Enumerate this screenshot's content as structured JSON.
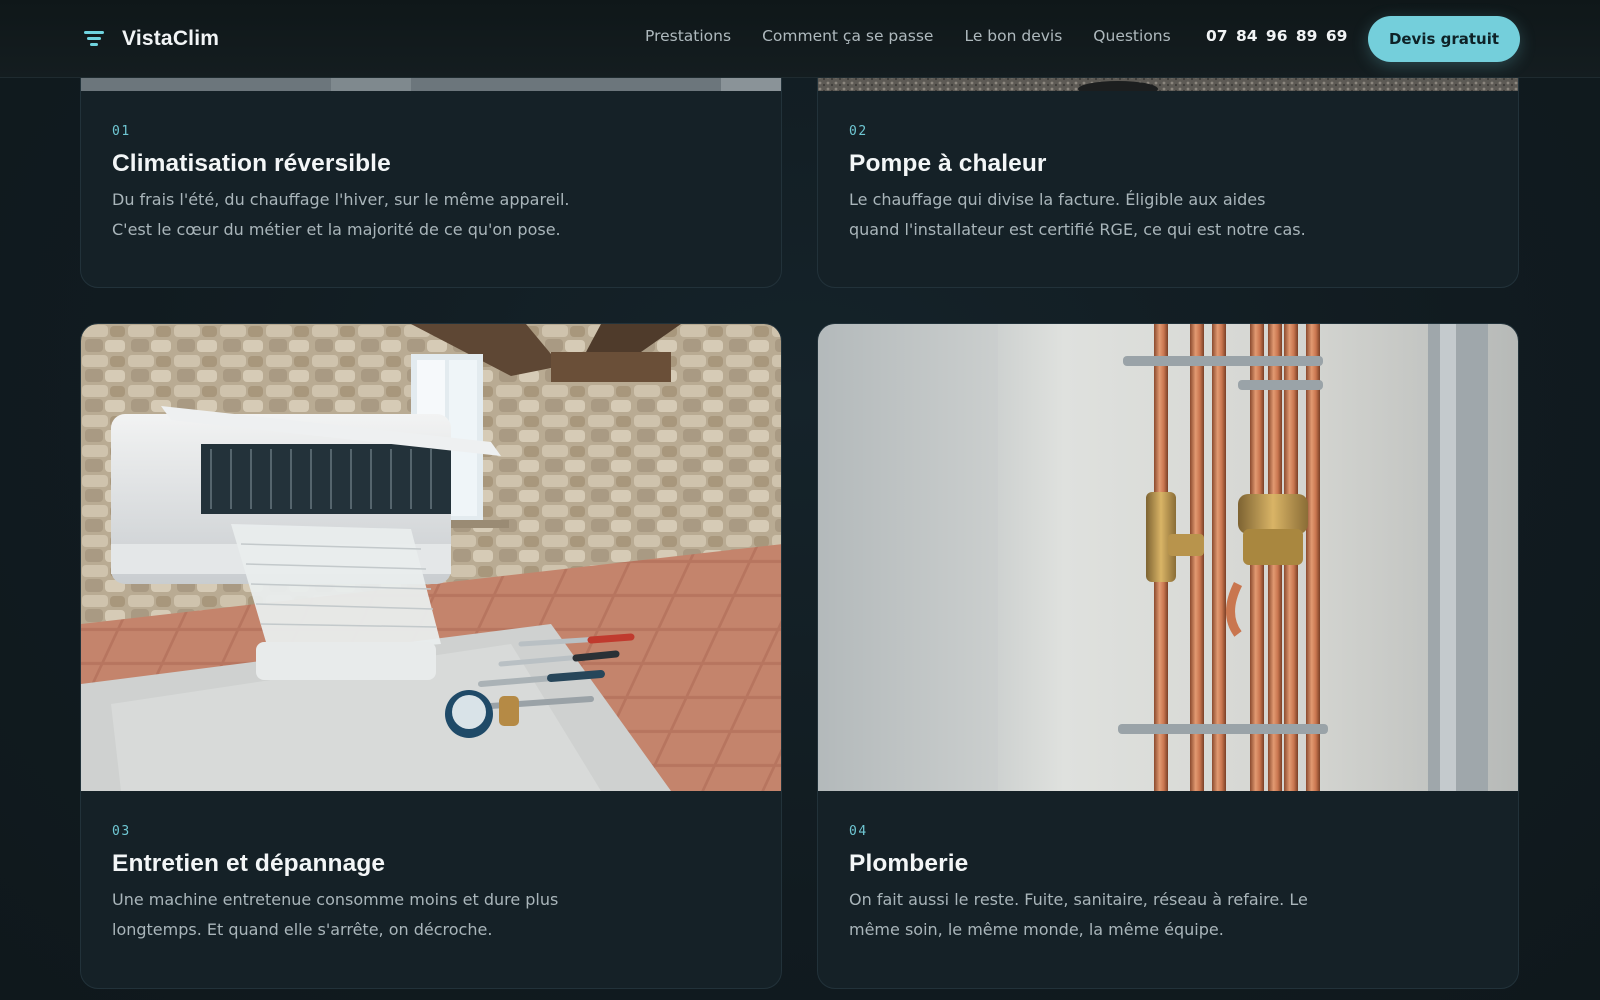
{
  "header": {
    "brand": "VistaClim",
    "nav": [
      "Prestations",
      "Comment ça se passe",
      "Le bon devis",
      "Questions"
    ],
    "phone": "07 84 96 89 69",
    "cta_label": "Devis gratuit"
  },
  "services": [
    {
      "number": "01",
      "title": "Climatisation réversible",
      "desc_lines": [
        "Du frais l'été, du chauffage l'hiver, sur le même appareil.",
        "C'est le cœur du métier et la majorité de ce qu'on pose."
      ]
    },
    {
      "number": "02",
      "title": "Pompe à chaleur",
      "desc_lines": [
        "Le chauffage qui divise la facture. Éligible aux aides",
        "quand l'installateur est certifié RGE, ce qui est notre cas."
      ]
    },
    {
      "number": "03",
      "title": "Entretien et dépannage",
      "desc_lines": [
        "Une machine entretenue consomme moins et dure plus",
        "longtemps. Et quand elle s'arrête, on décroche."
      ]
    },
    {
      "number": "04",
      "title": "Plomberie",
      "desc_lines": [
        "On fait aussi le reste. Fuite, sanitaire, réseau à refaire. Le",
        "même soin, le même monde, la même équipe."
      ]
    }
  ],
  "colors": {
    "accent": "#74cfdb",
    "background": "#111c21",
    "card": "#152127",
    "copper": "#c9764f"
  },
  "icons": {
    "brand": "filter-lines-icon"
  }
}
